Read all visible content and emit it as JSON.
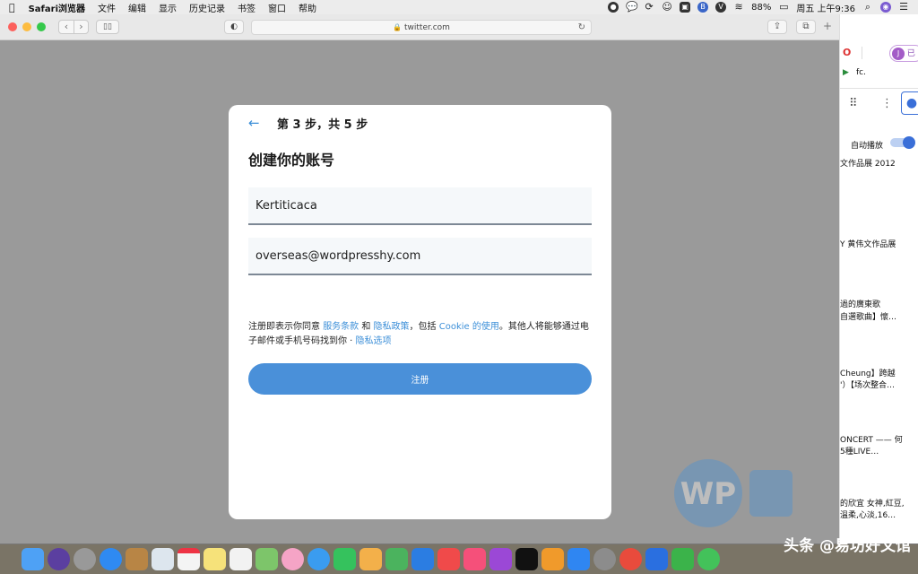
{
  "menubar": {
    "app_name": "Safari浏览器",
    "items": [
      "文件",
      "编辑",
      "显示",
      "历史记录",
      "书签",
      "窗口",
      "帮助"
    ],
    "battery": "88%",
    "datetime": "周五 上午9:36"
  },
  "browser": {
    "url": "twitter.com"
  },
  "signup": {
    "step": "第 3 步，共 5 步",
    "title": "创建你的账号",
    "name_value": "Kertiticaca",
    "email_value": "overseas@wordpresshy.com",
    "terms_prefix": "注册即表示你同意 ",
    "terms_link": "服务条款",
    "and": " 和 ",
    "privacy_link": "隐私政策",
    "including": "，包括 ",
    "cookie_link": "Cookie 的使用",
    "terms_suffix": "。其他人将能够通过电子邮件或手机号码找到你 · ",
    "privacy_options_link": "隐私选项",
    "button_label": "注册"
  },
  "right_panel": {
    "avatar_letter": "J",
    "profile_text": "已",
    "bookmark": "fc.",
    "autoplay": "自动播放",
    "items": [
      "文作品展 2012",
      "Y 黄伟文作品展",
      "過的廣東歌",
      "自選歌曲】懷…",
      "Cheung】跨越",
      "'）【场次整合…",
      "ONCERT —— 何",
      "5種LIVE…",
      "的欣宜 女神,紅豆,",
      "溫柔,心淡,16…"
    ]
  },
  "watermark": "头条 @易坊好文馆"
}
